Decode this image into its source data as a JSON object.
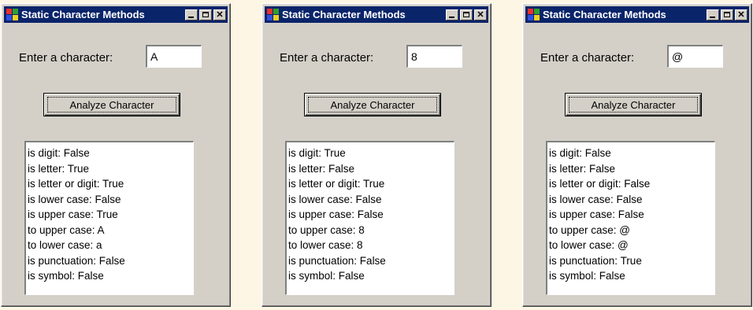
{
  "windows": [
    {
      "title": "Static Character Methods",
      "prompt": "Enter a character:",
      "input_value": "A",
      "button_label": "Analyze Character",
      "results": [
        "is digit: False",
        "is letter: True",
        "is letter or digit: True",
        "is lower case: False",
        "is upper case: True",
        "to upper case: A",
        "to lower case: a",
        "is punctuation: False",
        "is symbol: False"
      ]
    },
    {
      "title": "Static Character Methods",
      "prompt": "Enter a character:",
      "input_value": "8",
      "button_label": "Analyze Character",
      "results": [
        "is digit: True",
        "is letter: False",
        "is letter or digit: True",
        "is lower case: False",
        "is upper case: False",
        "to upper case: 8",
        "to lower case: 8",
        "is punctuation: False",
        "is symbol: False"
      ]
    },
    {
      "title": "Static Character Methods",
      "prompt": "Enter a character:",
      "input_value": "@",
      "button_label": "Analyze Character",
      "results": [
        "is digit: False",
        "is letter: False",
        "is letter or digit: False",
        "is lower case: False",
        "is upper case: False",
        "to upper case: @",
        "to lower case: @",
        "is punctuation: True",
        "is symbol: False"
      ]
    }
  ],
  "colors": {
    "titlebar": "#0a246a",
    "window_face": "#d4d0c8",
    "page_background": "#fdf6e4"
  },
  "icons": {
    "app": "app-icon",
    "minimize": "minimize-icon",
    "maximize": "maximize-icon",
    "close": "close-icon"
  }
}
